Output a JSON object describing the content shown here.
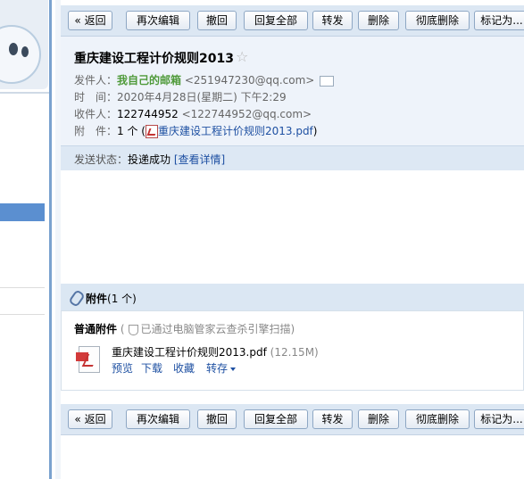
{
  "toolbar": {
    "back": "« 返回",
    "reedit": "再次编辑",
    "recall": "撤回",
    "reply_all": "回复全部",
    "forward": "转发",
    "delete": "删除",
    "delete_forever": "彻底删除",
    "mark_as": "标记为..."
  },
  "mail": {
    "subject": "重庆建设工程计价规则2013",
    "star": "☆",
    "from_label": "发件人：",
    "from_name": "我自己的邮箱",
    "from_email": "<251947230@qq.com>",
    "time_label": "时　间：",
    "time_value": "2020年4月28日(星期二) 下午2:29",
    "to_label": "收件人：",
    "to_name": "122744952",
    "to_email": "<122744952@qq.com>",
    "att_label": "附　件：",
    "att_count": "1 个 (",
    "att_file": "重庆建设工程计价规则2013.pdf",
    "att_close": ")",
    "status_label": "发送状态：",
    "status_value": "投递成功",
    "status_link": "[查看详情]"
  },
  "attachments": {
    "title": "附件",
    "count": "(1 个)",
    "normal_label": "普通附件",
    "scan_note_open": "(",
    "scan_note": "已通过电脑管家云查杀引擎扫描)",
    "file_name": "重庆建设工程计价规则2013.pdf",
    "file_size": "(12.15M)",
    "actions": {
      "preview": "预览",
      "download": "下载",
      "collect": "收藏",
      "save_to": "转存"
    }
  },
  "colors": {
    "toolbar_bg": "#dce7f3",
    "header_bg": "#eef3fa",
    "link": "#1e50a2",
    "sender_green": "#4f9a3a",
    "sidebar_selected": "#5b8fd0"
  }
}
